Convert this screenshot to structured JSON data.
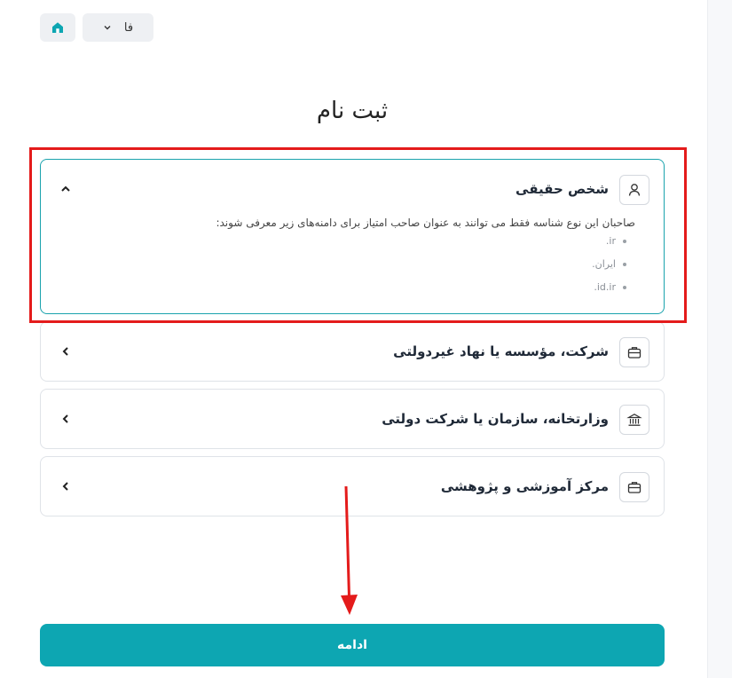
{
  "header": {
    "language_label": "فا",
    "home_icon": "home-icon",
    "chevron_icon": "chevron-down-icon"
  },
  "page_title": "ثبت نام",
  "cards": [
    {
      "title": "شخص حقیقی",
      "icon": "user-icon",
      "expanded": true,
      "description": "صاحبان این نوع شناسه فقط می توانند به عنوان صاحب امتیاز برای دامنه‌های زیر معرفی شوند:",
      "domains": [
        ".ir",
        ".ایران",
        ".id.ir"
      ]
    },
    {
      "title": "شرکت، مؤسسه یا نهاد غیردولتی",
      "icon": "briefcase-icon",
      "expanded": false
    },
    {
      "title": "وزارتخانه، سازمان یا شرکت دولتی",
      "icon": "bank-icon",
      "expanded": false
    },
    {
      "title": "مرکز آموزشی و پژوهشی",
      "icon": "briefcase-icon",
      "expanded": false
    }
  ],
  "continue_label": "ادامه",
  "colors": {
    "accent": "#0da6b2",
    "highlight": "#e41b1b",
    "border": "#dfe3e8"
  }
}
